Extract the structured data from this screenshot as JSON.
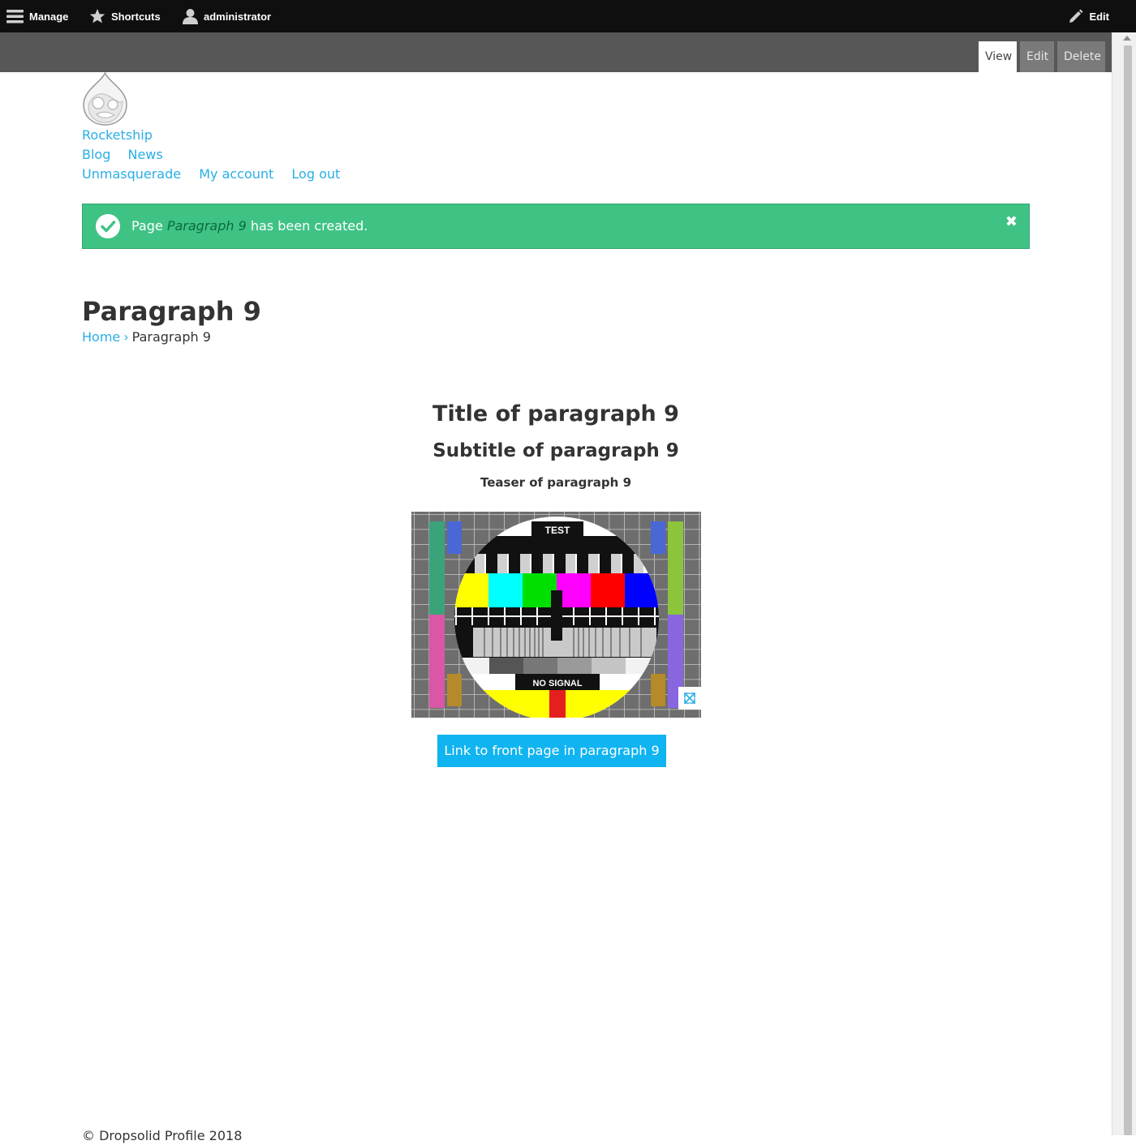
{
  "toolbar": {
    "manage": "Manage",
    "shortcuts": "Shortcuts",
    "user": "administrator",
    "edit": "Edit"
  },
  "tasks": {
    "view": "View",
    "edit": "Edit",
    "delete": "Delete"
  },
  "site": {
    "name": "Rocketship"
  },
  "main_menu": [
    "Blog",
    "News"
  ],
  "account_menu": [
    "Unmasquerade",
    "My account",
    "Log out"
  ],
  "message": {
    "prefix": "Page ",
    "item": "Paragraph 9",
    "suffix": " has been created.",
    "close": "✖"
  },
  "page": {
    "title": "Paragraph 9"
  },
  "breadcrumb": {
    "home": "Home",
    "separator": "›",
    "current": "Paragraph 9"
  },
  "paragraph": {
    "title": "Title of paragraph 9",
    "subtitle": "Subtitle of paragraph 9",
    "teaser": "Teaser of paragraph 9",
    "image_text_top": "TEST",
    "image_text_bottom": "NO SIGNAL",
    "button": "Link to front page in paragraph 9"
  },
  "footer": {
    "copyright": "© Dropsolid Profile 2018"
  },
  "colors": {
    "accent": "#29aee6",
    "button": "#0fb4f0",
    "success": "#3fc385",
    "toolbar": "#0f0f0f",
    "tasks_bar": "#575757"
  }
}
